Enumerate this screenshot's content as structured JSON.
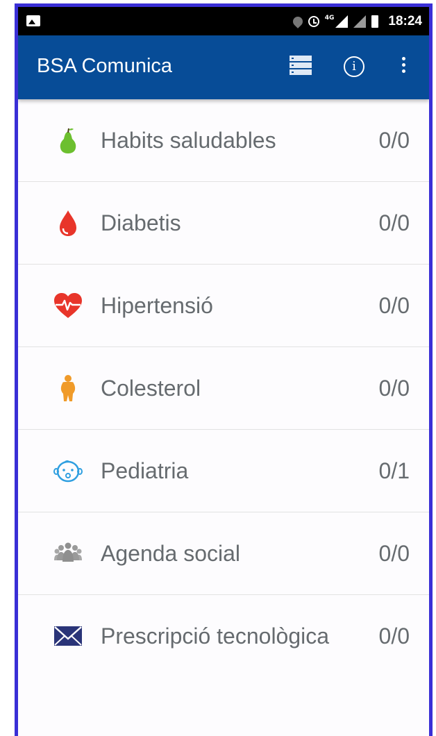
{
  "status_bar": {
    "time": "18:24",
    "network": "4G"
  },
  "app_bar": {
    "title": "BSA Comunica",
    "actions": [
      "list-icon",
      "info-icon",
      "more-vert-icon"
    ]
  },
  "categories": [
    {
      "label": "Habits saludables",
      "count": "0/0",
      "icon": "pear-icon",
      "color": "#6cbf2f"
    },
    {
      "label": "Diabetis",
      "count": "0/0",
      "icon": "blood-drop-icon",
      "color": "#e8352a"
    },
    {
      "label": "Hipertensió",
      "count": "0/0",
      "icon": "heartbeat-icon",
      "color": "#e8352a"
    },
    {
      "label": "Colesterol",
      "count": "0/0",
      "icon": "person-icon",
      "color": "#f09b2a"
    },
    {
      "label": "Pediatria",
      "count": "0/1",
      "icon": "baby-face-icon",
      "color": "#2f9fe0"
    },
    {
      "label": "Agenda social",
      "count": "0/0",
      "icon": "group-icon",
      "color": "#8f8f8f"
    },
    {
      "label": "Prescripció tecnològica",
      "count": "0/0",
      "icon": "envelope-icon",
      "color": "#2a3478"
    }
  ],
  "colors": {
    "app_bar": "#074c97",
    "text": "#666b6f",
    "frame": "#3a2fd6"
  }
}
